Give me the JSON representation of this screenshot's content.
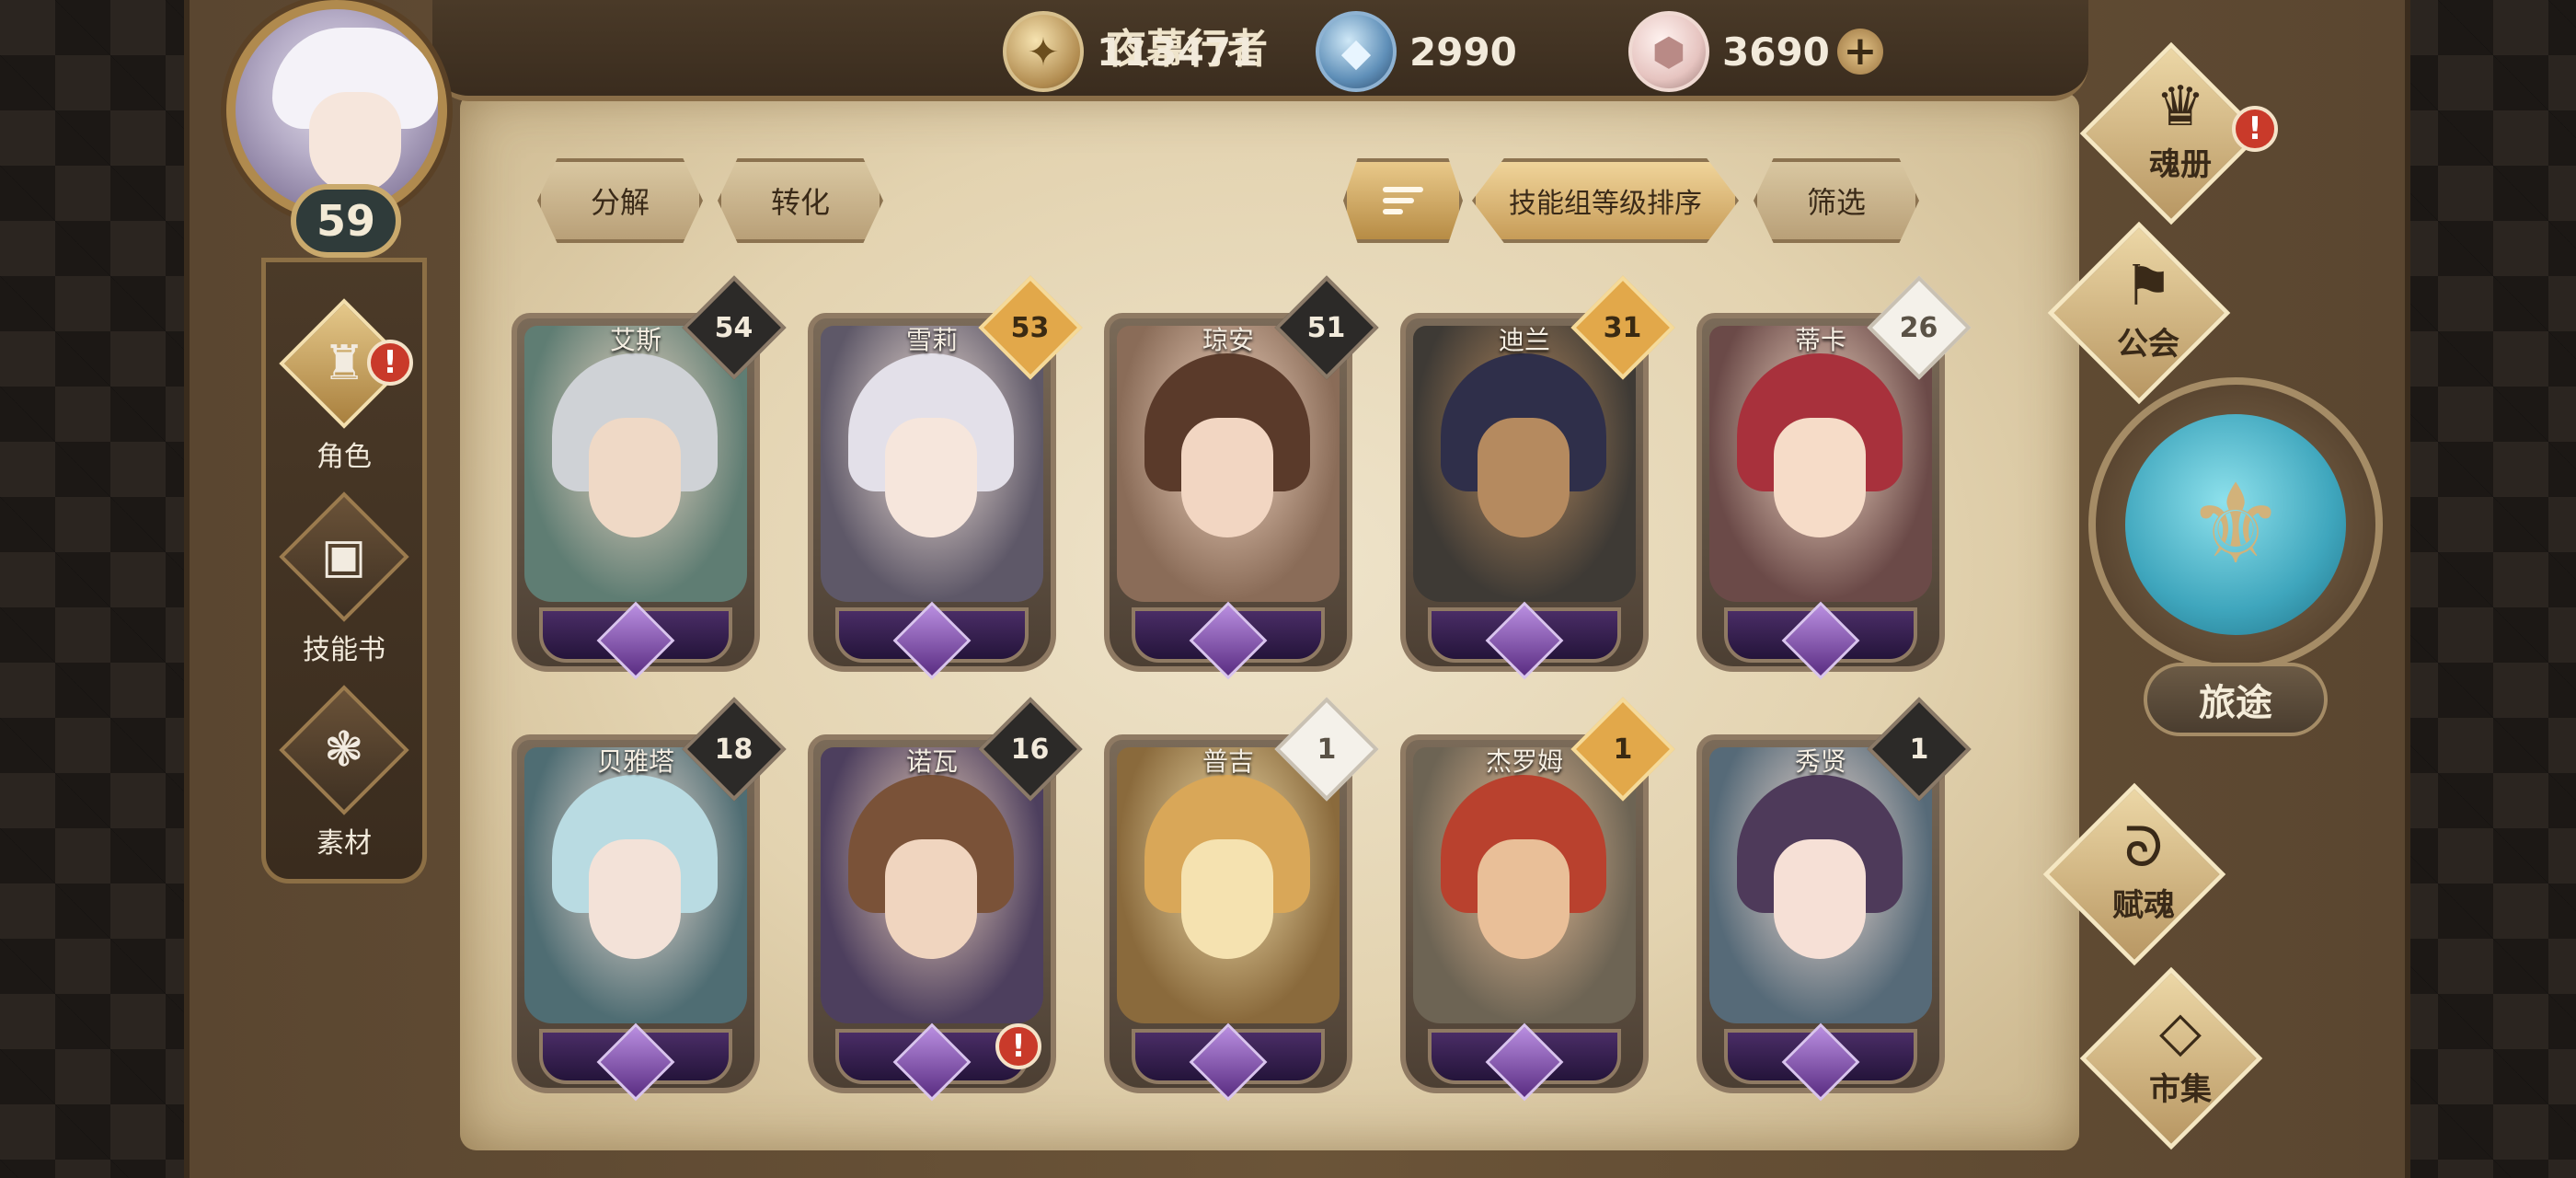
{
  "player": {
    "name": "夜幕行者",
    "level": "59"
  },
  "currencies": {
    "gold": "113471",
    "crystal": "2990",
    "gem": "3690",
    "plus": "+"
  },
  "left_menu": [
    {
      "label": "角色",
      "icon": "helmet-icon",
      "glyph": "♜",
      "active": true,
      "alert": "!"
    },
    {
      "label": "技能书",
      "icon": "skill-book-icon",
      "glyph": "▣",
      "active": false
    },
    {
      "label": "素材",
      "icon": "materials-icon",
      "glyph": "❃",
      "active": false
    }
  ],
  "toolbar": {
    "decompose": "分解",
    "convert": "转化",
    "sort": "技能组等级排序",
    "filter": "筛选"
  },
  "heroes": [
    {
      "name": "艾斯",
      "level": "54",
      "badge": "dark",
      "hair": "#cfd2d6",
      "bg": "#5f7d73",
      "skin": "#efd9c6"
    },
    {
      "name": "雪莉",
      "level": "53",
      "badge": "gold",
      "hair": "#e3e0e9",
      "bg": "#5e5868",
      "skin": "#f6e6dc"
    },
    {
      "name": "琼安",
      "level": "51",
      "badge": "dark",
      "hair": "#5a3a2a",
      "bg": "#8a6c58",
      "skin": "#f2d6c2"
    },
    {
      "name": "迪兰",
      "level": "31",
      "badge": "gold",
      "hair": "#2f2f4a",
      "bg": "#3e3a35",
      "skin": "#b58a5f"
    },
    {
      "name": "蒂卡",
      "level": "26",
      "badge": "white",
      "hair": "#a8313c",
      "bg": "#6b4a48",
      "skin": "#f6dcc8"
    },
    {
      "name": "贝雅塔",
      "level": "18",
      "badge": "dark",
      "hair": "#b9dbe2",
      "bg": "#4f6d73",
      "skin": "#f3e2d8"
    },
    {
      "name": "诺瓦",
      "level": "16",
      "badge": "dark",
      "hair": "#7a5238",
      "bg": "#4d3f5e",
      "skin": "#f0d5bf",
      "alert": "!"
    },
    {
      "name": "普吉",
      "level": "1",
      "badge": "white",
      "hair": "#d9a758",
      "bg": "#8a6a3c",
      "skin": "#f5e2b0"
    },
    {
      "name": "杰罗姆",
      "level": "1",
      "badge": "gold",
      "hair": "#b9412e",
      "bg": "#6d6454",
      "skin": "#e9bf98"
    },
    {
      "name": "秀贤",
      "level": "1",
      "badge": "dark",
      "hair": "#4e3a5a",
      "bg": "#566a78",
      "skin": "#f6e0d6"
    }
  ],
  "right_nav": {
    "soul_book": "魂册",
    "guild": "公会",
    "journey": "旅途",
    "endow": "赋魂",
    "market": "市集",
    "alert": "!"
  },
  "colors": {
    "parchment": "#e3d3b0",
    "gold_accent": "#e2a84a",
    "alert_red": "#c93a2a",
    "journey_teal": "#3fa6bd"
  }
}
